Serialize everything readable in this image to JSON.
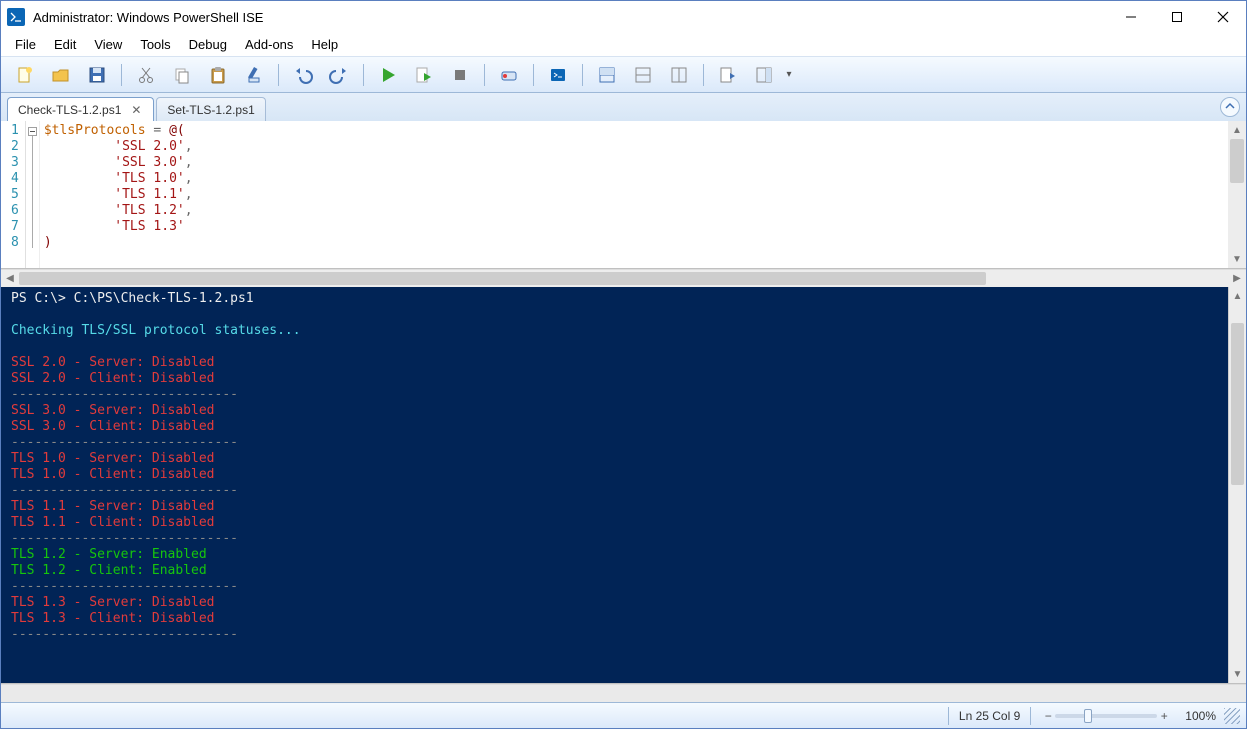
{
  "window": {
    "title": "Administrator: Windows PowerShell ISE",
    "controls": {
      "min": "—",
      "max": "☐",
      "close": "✕"
    }
  },
  "menu": [
    "File",
    "Edit",
    "View",
    "Tools",
    "Debug",
    "Add-ons",
    "Help"
  ],
  "toolbar_icons": [
    "new",
    "open",
    "save",
    "cut",
    "copy",
    "paste",
    "clear",
    "undo",
    "redo",
    "run",
    "run-selection",
    "stop",
    "breakpoint",
    "remote",
    "layout-both",
    "layout-script",
    "layout-console",
    "cmd-addon",
    "cmd-explorer"
  ],
  "tabs": [
    {
      "label": "Check-TLS-1.2.ps1",
      "active": true,
      "closable": true
    },
    {
      "label": "Set-TLS-1.2.ps1",
      "active": false,
      "closable": false
    }
  ],
  "editor": {
    "line_numbers": [
      "1",
      "2",
      "3",
      "4",
      "5",
      "6",
      "7",
      "8"
    ],
    "lines": [
      {
        "tokens": [
          [
            "var",
            "$tlsProtocols"
          ],
          [
            "op",
            " = "
          ],
          [
            "kw",
            "@("
          ]
        ]
      },
      {
        "indent": "         ",
        "tokens": [
          [
            "str",
            "'SSL 2.0'"
          ],
          [
            "op",
            ","
          ]
        ]
      },
      {
        "indent": "         ",
        "tokens": [
          [
            "str",
            "'SSL 3.0'"
          ],
          [
            "op",
            ","
          ]
        ]
      },
      {
        "indent": "         ",
        "tokens": [
          [
            "str",
            "'TLS 1.0'"
          ],
          [
            "op",
            ","
          ]
        ]
      },
      {
        "indent": "         ",
        "tokens": [
          [
            "str",
            "'TLS 1.1'"
          ],
          [
            "op",
            ","
          ]
        ]
      },
      {
        "indent": "         ",
        "tokens": [
          [
            "str",
            "'TLS 1.2'"
          ],
          [
            "op",
            ","
          ]
        ]
      },
      {
        "indent": "         ",
        "tokens": [
          [
            "str",
            "'TLS 1.3'"
          ]
        ]
      },
      {
        "tokens": [
          [
            "kw",
            ")"
          ]
        ]
      }
    ]
  },
  "console": {
    "prompt": "PS C:\\> C:\\PS\\Check-TLS-1.2.ps1",
    "blank1": " ",
    "status": "Checking TLS/SSL protocol statuses...",
    "blank2": " ",
    "blocks": [
      {
        "lines": [
          "SSL 2.0 - Server: Disabled",
          "SSL 2.0 - Client: Disabled"
        ],
        "cls": "red"
      },
      {
        "lines": [
          "SSL 3.0 - Server: Disabled",
          "SSL 3.0 - Client: Disabled"
        ],
        "cls": "red"
      },
      {
        "lines": [
          "TLS 1.0 - Server: Disabled",
          "TLS 1.0 - Client: Disabled"
        ],
        "cls": "red"
      },
      {
        "lines": [
          "TLS 1.1 - Server: Disabled",
          "TLS 1.1 - Client: Disabled"
        ],
        "cls": "red"
      },
      {
        "lines": [
          "TLS 1.2 - Server: Enabled",
          "TLS 1.2 - Client: Enabled"
        ],
        "cls": "green"
      },
      {
        "lines": [
          "TLS 1.3 - Server: Disabled",
          "TLS 1.3 - Client: Disabled"
        ],
        "cls": "red"
      }
    ],
    "divider": "-----------------------------"
  },
  "status": {
    "pos": "Ln 25  Col 9",
    "zoom": "100%"
  }
}
